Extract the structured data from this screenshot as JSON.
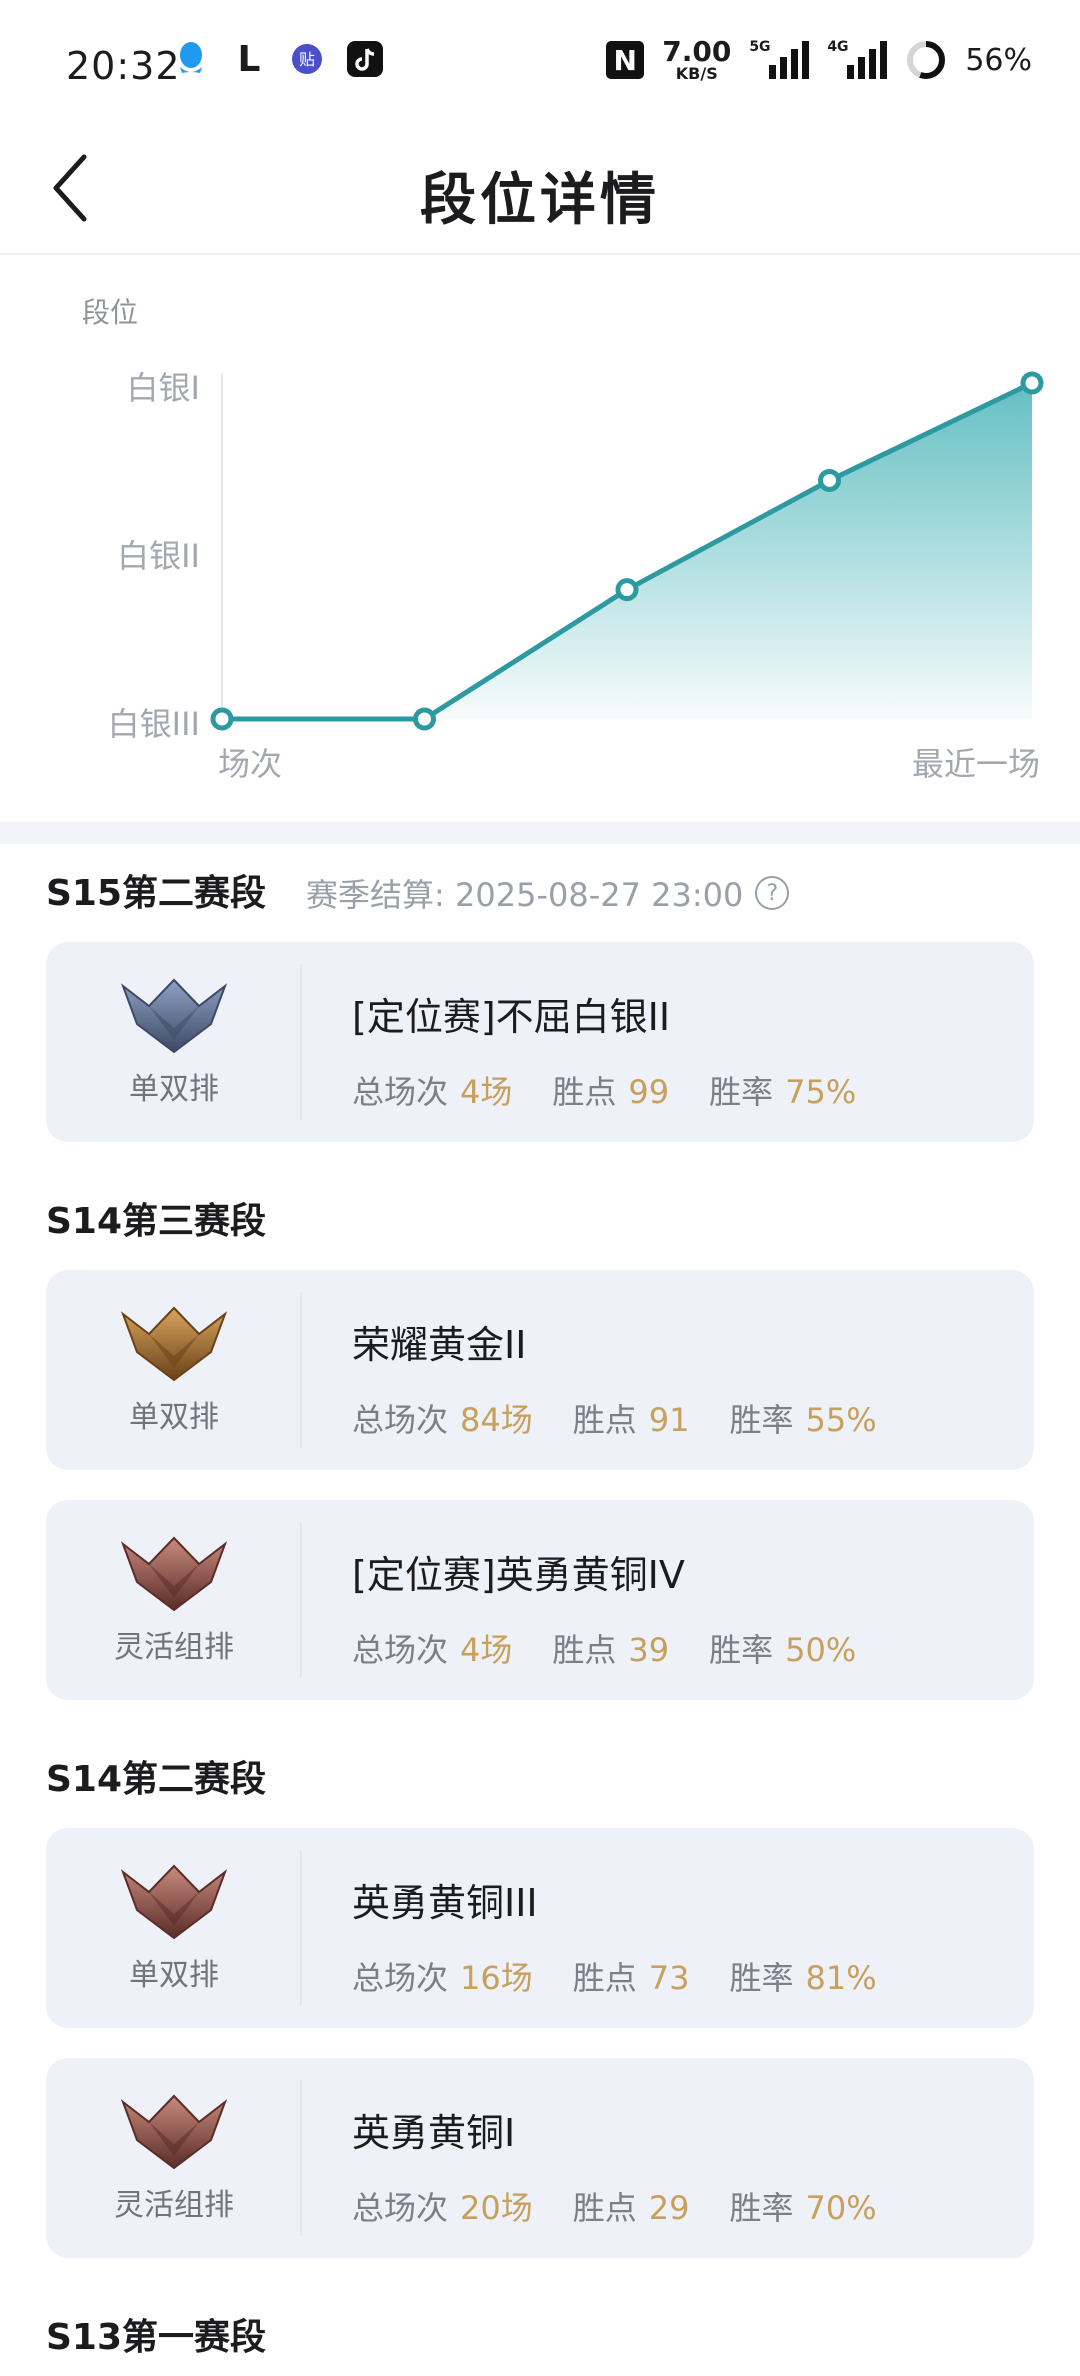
{
  "status_bar": {
    "time": "20:32",
    "net_speed_value": "7.00",
    "net_speed_unit": "KB/S",
    "signal1_label": "5G",
    "signal2_label": "4G",
    "battery": "56%"
  },
  "header": {
    "title": "段位详情"
  },
  "chart_data": {
    "type": "line",
    "title": "段位",
    "y_categories": [
      "白银III",
      "白银II",
      "白银I"
    ],
    "x_start_label": "场次",
    "x_end_label": "最近一场",
    "points": [
      0,
      0,
      0.77,
      1.42,
      2.0
    ],
    "line_color": "#2c9aa0",
    "fill_color": "#5cbcc0"
  },
  "seasons": [
    {
      "title": "S15第二赛段",
      "settlement": "赛季结算: 2025-08-27 23:00",
      "cards": [
        {
          "rank": "[定位赛]不屈白银II",
          "mode": "单双排",
          "badge": "silver",
          "games_label": "总场次",
          "games": "4场",
          "points_label": "胜点",
          "points": "99",
          "winrate_label": "胜率",
          "winrate": "75%"
        }
      ]
    },
    {
      "title": "S14第三赛段",
      "settlement": "",
      "cards": [
        {
          "rank": "荣耀黄金II",
          "mode": "单双排",
          "badge": "gold",
          "games_label": "总场次",
          "games": "84场",
          "points_label": "胜点",
          "points": "91",
          "winrate_label": "胜率",
          "winrate": "55%"
        },
        {
          "rank": "[定位赛]英勇黄铜IV",
          "mode": "灵活组排",
          "badge": "bronze",
          "games_label": "总场次",
          "games": "4场",
          "points_label": "胜点",
          "points": "39",
          "winrate_label": "胜率",
          "winrate": "50%"
        }
      ]
    },
    {
      "title": "S14第二赛段",
      "settlement": "",
      "cards": [
        {
          "rank": "英勇黄铜III",
          "mode": "单双排",
          "badge": "bronze",
          "games_label": "总场次",
          "games": "16场",
          "points_label": "胜点",
          "points": "73",
          "winrate_label": "胜率",
          "winrate": "81%"
        },
        {
          "rank": "英勇黄铜I",
          "mode": "灵活组排",
          "badge": "bronze",
          "games_label": "总场次",
          "games": "20场",
          "points_label": "胜点",
          "points": "29",
          "winrate_label": "胜率",
          "winrate": "70%"
        }
      ]
    },
    {
      "title": "S13第一赛段",
      "settlement": "",
      "cards": []
    }
  ],
  "colors": {
    "silver": [
      "#3d4a66",
      "#8fa1c4"
    ],
    "gold": [
      "#6b4118",
      "#d8a560"
    ],
    "bronze": [
      "#5a2d28",
      "#c98a7e"
    ]
  }
}
